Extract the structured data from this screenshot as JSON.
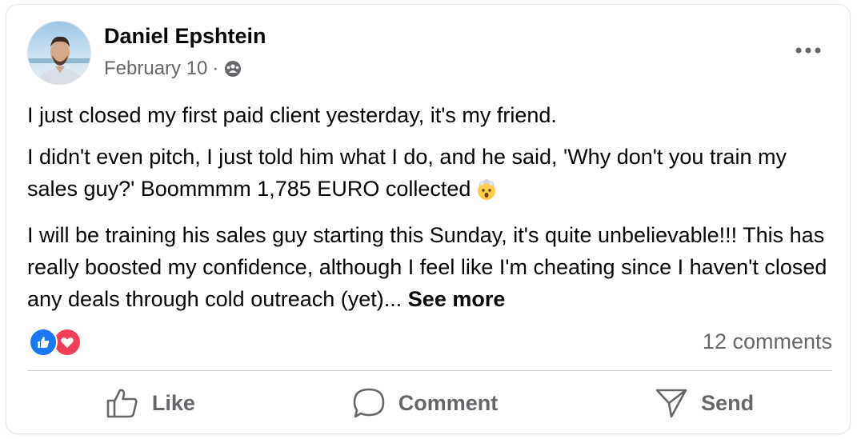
{
  "post": {
    "author": "Daniel Epshtein",
    "date": "February 10",
    "separator": "·",
    "privacy_icon": "group-privacy-icon",
    "paragraphs": [
      "I just closed my first paid client yesterday, it's my friend.",
      "I didn't even pitch, I just told him what I do, and he said, 'Why don't you train my sales guy?' Boommmm 1,785 EURO collected",
      "I will be training his sales guy starting this Sunday, it's quite unbelievable!!! This has really boosted my confidence, although I feel like I'm cheating since I haven't closed any deals through cold outreach (yet)..."
    ],
    "emoji": "exploding-head-emoji",
    "see_more": "See more"
  },
  "reactions": {
    "types": [
      "like",
      "love"
    ],
    "comments": "12 comments"
  },
  "actions": {
    "like": "Like",
    "comment": "Comment",
    "send": "Send"
  },
  "colors": {
    "like_blue": "#1877f2",
    "love_red": "#f33e58",
    "secondary_text": "#65676b"
  }
}
